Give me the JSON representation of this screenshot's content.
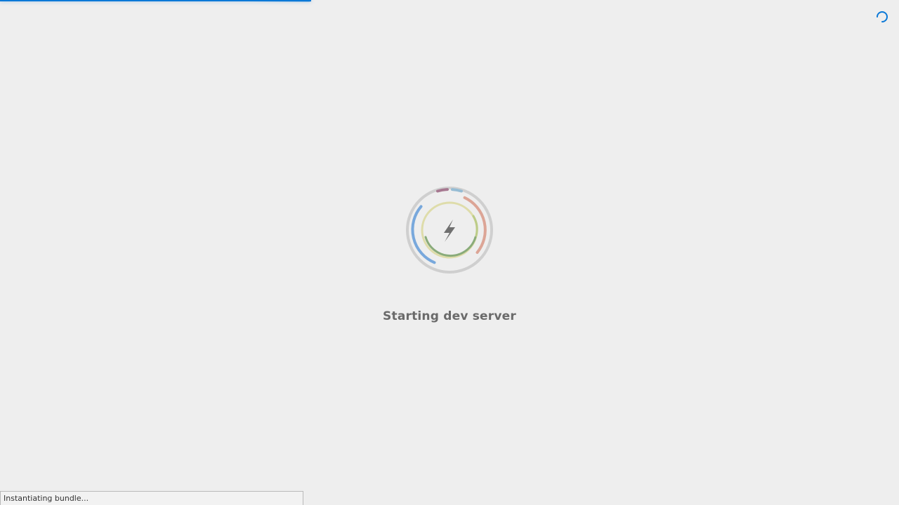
{
  "progress": {
    "fraction": 0.346
  },
  "logo": {
    "icon": "lightning-bolt-icon"
  },
  "loading": {
    "title": "Starting dev server",
    "status": "Instantiating bundle..."
  },
  "colors": {
    "background": "#eeeeee",
    "accent": "#0a78d7",
    "text": "#6a6a6a",
    "ring": "#cfcfcf",
    "blue_arc": "#78a8dc",
    "red_arc": "#dca596",
    "purple_arc": "#a67890",
    "teal_arc": "#96bcd4",
    "green_arc": "#89ab7a",
    "yellow_arc": "#dedcaa"
  }
}
